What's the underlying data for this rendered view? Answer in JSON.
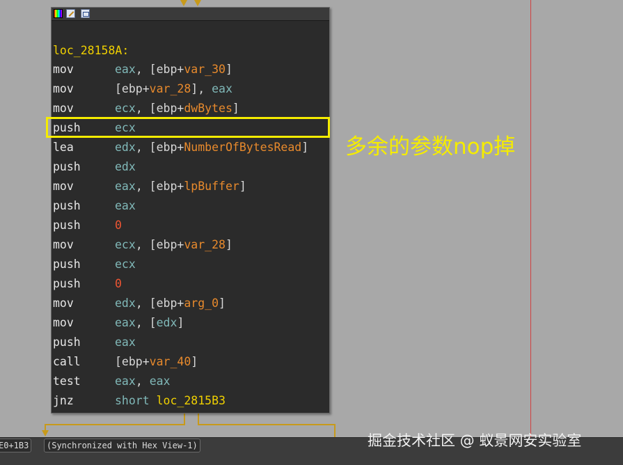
{
  "node": {
    "location_label": "loc_28158A:",
    "instructions": [
      {
        "mnemonic": "mov",
        "op1": "eax",
        "pre": ", [ebp+",
        "var": "var_30",
        "post": "]"
      },
      {
        "mnemonic": "mov",
        "pre0": "[ebp+",
        "var": "var_28",
        "mid": "], ",
        "op2": "eax"
      },
      {
        "mnemonic": "mov",
        "op1": "ecx",
        "pre": ", [ebp+",
        "var": "dwBytes",
        "post": "]"
      },
      {
        "mnemonic": "push",
        "op1": "ecx"
      },
      {
        "mnemonic": "lea",
        "op1": "edx",
        "pre": ", [ebp+",
        "var": "NumberOfBytesRead",
        "post": "]"
      },
      {
        "mnemonic": "push",
        "op1": "edx"
      },
      {
        "mnemonic": "mov",
        "op1": "eax",
        "pre": ", [ebp+",
        "var": "lpBuffer",
        "post": "]"
      },
      {
        "mnemonic": "push",
        "op1": "eax"
      },
      {
        "mnemonic": "push",
        "num": "0"
      },
      {
        "mnemonic": "mov",
        "op1": "ecx",
        "pre": ", [ebp+",
        "var": "var_28",
        "post": "]"
      },
      {
        "mnemonic": "push",
        "op1": "ecx"
      },
      {
        "mnemonic": "push",
        "num": "0"
      },
      {
        "mnemonic": "mov",
        "op1": "edx",
        "pre": ", [ebp+",
        "var": "arg_0",
        "post": "]"
      },
      {
        "mnemonic": "mov",
        "op1": "eax",
        "pre": ", [",
        "reg2": "edx",
        "post": "]"
      },
      {
        "mnemonic": "push",
        "op1": "eax"
      },
      {
        "mnemonic": "call",
        "pre0": "[ebp+",
        "var": "var_40",
        "post": "]"
      },
      {
        "mnemonic": "test",
        "op1": "eax",
        "mid": ", ",
        "op2": "eax"
      },
      {
        "mnemonic": "jnz",
        "kw": "short ",
        "lbl": "loc_2815B3"
      }
    ]
  },
  "annotation": {
    "text": "多余的参数nop掉",
    "color": "#f5ec00"
  },
  "statusbar": {
    "address": "E0+1B3",
    "sync_text": "(Synchronized with Hex View-1)"
  },
  "watermark": "掘金技术社区 @ 蚁景网安实验室",
  "colors": {
    "background": "#a8a8a8",
    "node_bg": "#2b2b2b",
    "register": "#80b8b8",
    "variable": "#e88a2c",
    "immediate": "#ee5533",
    "label": "#f0d000",
    "edge": "#c89a1a",
    "guide_line": "#d04040"
  }
}
